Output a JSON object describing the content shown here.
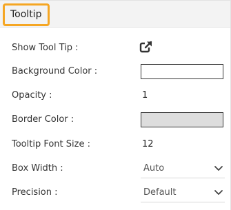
{
  "header": {
    "title": "Tooltip"
  },
  "rows": {
    "show_tooltip": {
      "label": "Show Tool Tip :"
    },
    "background_color": {
      "label": "Background Color :",
      "color": "#ffffff"
    },
    "opacity": {
      "label": "Opacity :",
      "value": "1"
    },
    "border_color": {
      "label": "Border Color :",
      "color": "#dddddd"
    },
    "font_size": {
      "label": "Tooltip Font Size :",
      "value": "12"
    },
    "box_width": {
      "label": "Box Width :",
      "value": "Auto"
    },
    "precision": {
      "label": "Precision :",
      "value": "Default"
    }
  },
  "icons": {
    "external_link": "external-link-icon",
    "dropdown": "chevron-down-icon"
  }
}
